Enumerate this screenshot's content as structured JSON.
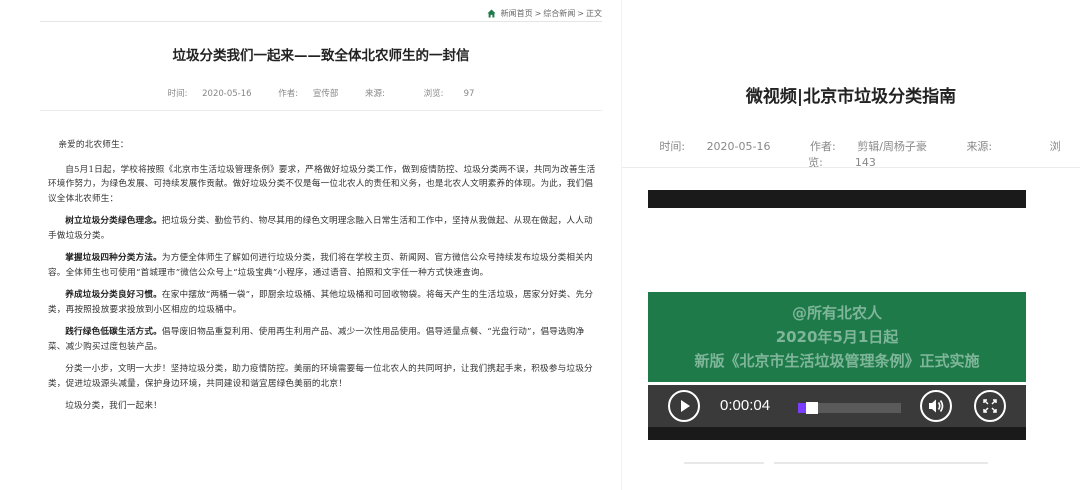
{
  "article": {
    "breadcrumb": [
      "新闻首页",
      "综合新闻",
      "正文"
    ],
    "breadcrumb_sep": ">",
    "title": "垃圾分类我们一起来——致全体北农师生的一封信",
    "meta": {
      "time_label": "时间:",
      "time": "2020-05-16",
      "author_label": "作者:",
      "author": "宣传部",
      "source_label": "来源:",
      "source": "",
      "views_label": "浏览:",
      "views": "97"
    },
    "greeting": "亲爱的北农师生：",
    "p1": "自5月1日起，学校将按照《北京市生活垃圾管理条例》要求，严格做好垃圾分类工作，做到疫情防控、垃圾分类两不误，共同为改善生活环境作努力，为绿色发展、可持续发展作贡献。做好垃圾分类不仅是每一位北农人的责任和义务，也是北农人文明素养的体现。为此，我们倡议全体北农师生：",
    "p2_bold": "树立垃圾分类绿色理念。",
    "p2_rest": "把垃圾分类、勤俭节约、物尽其用的绿色文明理念融入日常生活和工作中，坚持从我做起、从现在做起，人人动手做垃圾分类。",
    "p3_bold": "掌握垃圾四种分类方法。",
    "p3_rest": "为方便全体师生了解如何进行垃圾分类，我们将在学校主页、新闻网、官方微信公众号持续发布垃圾分类相关内容。全体师生也可使用“首城理市”微信公众号上“垃圾宝典”小程序，通过语音、拍照和文字任一种方式快速查询。",
    "p4_bold": "养成垃圾分类良好习惯。",
    "p4_rest": "在家中摆放“两桶一袋”，即厨余垃圾桶、其他垃圾桶和可回收物袋。将每天产生的生活垃圾，居家分好类、先分类，再按照投放要求投放到小区相应的垃圾桶中。",
    "p5_bold": "践行绿色低碳生活方式。",
    "p5_rest": "倡导废旧物品重复利用、使用再生利用产品、减少一次性用品使用。倡导适量点餐、“光盘行动”，倡导选购净菜、减少购买过度包装产品。",
    "p6": "分类一小步，文明一大步！坚持垃圾分类，助力疫情防控。美丽的环境需要每一位北农人的共同呵护，让我们携起手来，积极参与垃圾分类，促进垃圾源头减量，保护身边环境，共同建设和谐宜居绿色美丽的北京！",
    "p7": "垃圾分类，我们一起来！"
  },
  "video_page": {
    "title": "微视频|北京市垃圾分类指南",
    "meta": {
      "time_label": "时间:",
      "time": "2020-05-16",
      "author_label": "作者:",
      "author": "剪辑/周杨子豪",
      "source_label": "来源:",
      "source": "",
      "views_label": "浏览:",
      "views": "143"
    },
    "banner_lines": [
      "@所有北农人",
      "2020年5月1日起",
      "新版《北京市生活垃圾管理条例》正式实施"
    ],
    "player": {
      "current_time": "0:00:04",
      "progress": 0.08,
      "play_icon": "play-icon",
      "volume_icon": "volume-icon",
      "fullscreen_icon": "fullscreen-icon"
    },
    "colors": {
      "banner_green": "#1f7a4a",
      "progress": "#7a3cff"
    }
  }
}
